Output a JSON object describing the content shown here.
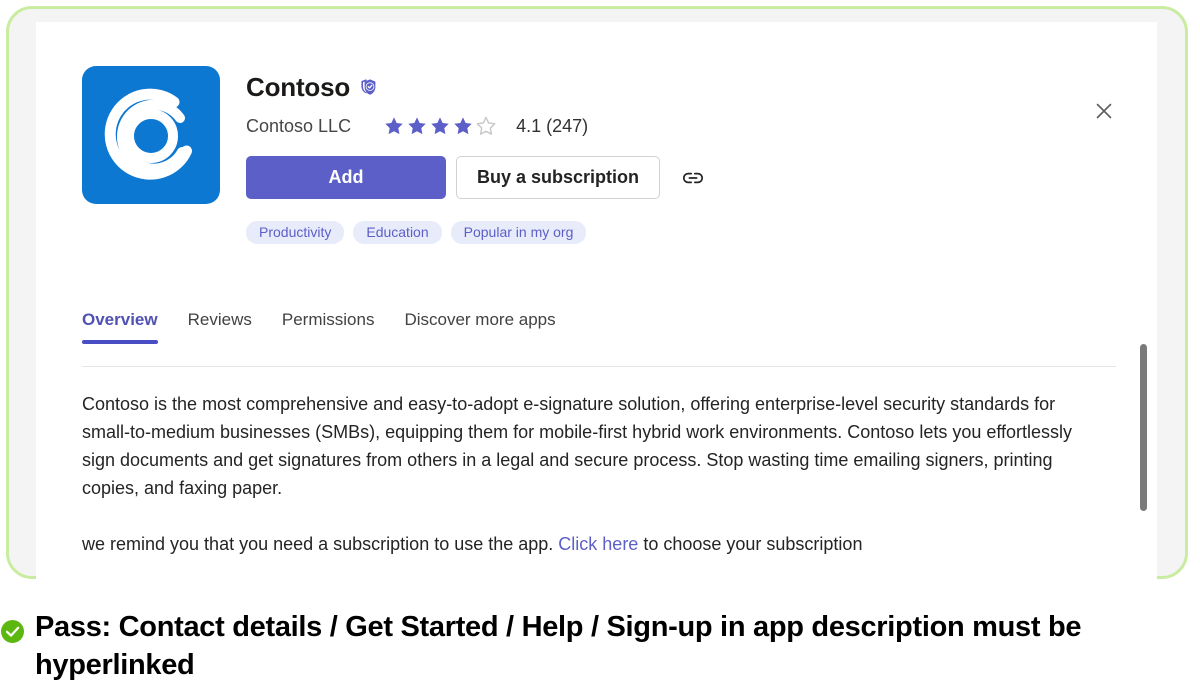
{
  "colors": {
    "accent_purple": "#5b5fc7",
    "tab_active": "#4f52b2",
    "icon_blue": "#0d78d1",
    "chip_bg": "#e8ebfa",
    "frame_green": "#c9eca0",
    "pass_green": "#5cb811",
    "link_color": "#5b5fc7"
  },
  "app": {
    "icon_name": "contoso-app-icon",
    "name": "Contoso",
    "verified_icon": "verified-shield-icon",
    "publisher": "Contoso LLC",
    "rating_value": "4.1",
    "rating_display": "4.1 (247)",
    "rating_count": "247",
    "stars_filled": 4,
    "stars_total": 5
  },
  "actions": {
    "add_label": "Add",
    "buy_label": "Buy a subscription",
    "copy_link_icon": "link-icon",
    "close_icon": "close-icon"
  },
  "chips": [
    {
      "label": "Productivity"
    },
    {
      "label": "Education"
    },
    {
      "label": "Popular in my org"
    }
  ],
  "tabs": [
    {
      "label": "Overview",
      "active": true
    },
    {
      "label": "Reviews",
      "active": false
    },
    {
      "label": "Permissions",
      "active": false
    },
    {
      "label": "Discover more apps",
      "active": false
    }
  ],
  "overview": {
    "paragraph_1": "Contoso is the most comprehensive and easy-to-adopt e-signature solution, offering enterprise-level security standards for small-to-medium businesses (SMBs), equipping them for mobile-first hybrid work environments. Contoso lets you effortlessly sign documents and get signatures from others in a legal and secure process. Stop wasting time emailing signers, printing copies, and faxing paper.",
    "paragraph_2_before": "we remind you that  you need a subscription to use the app. ",
    "paragraph_2_link": "Click here",
    "paragraph_2_after": " to choose your subscription"
  },
  "caption": {
    "status_icon": "check-circle-icon",
    "text": "Pass: Contact details / Get Started / Help / Sign-up in app description must be hyperlinked"
  }
}
